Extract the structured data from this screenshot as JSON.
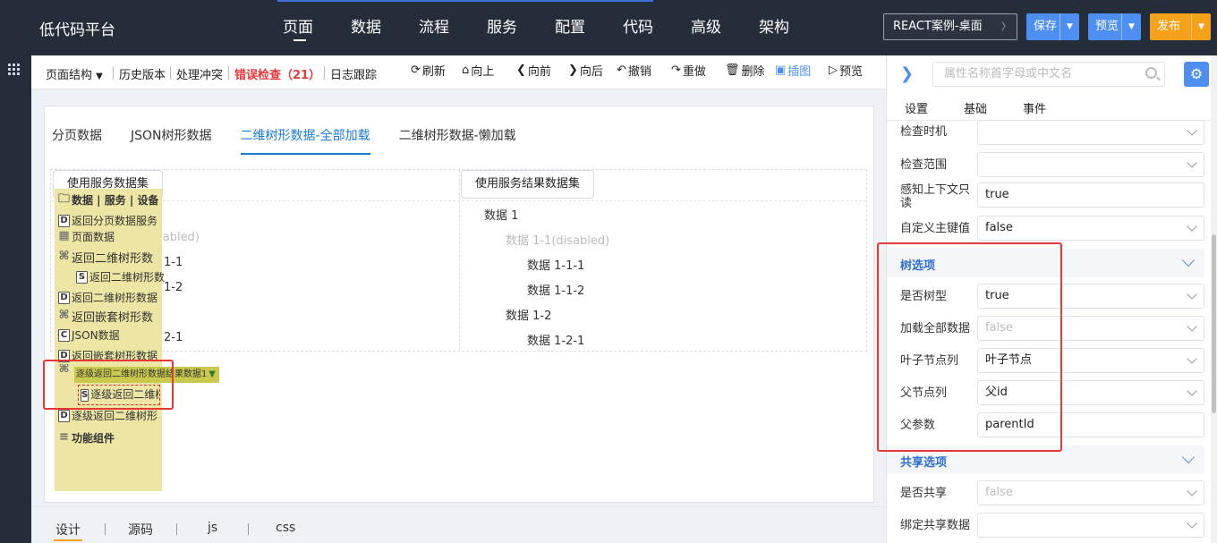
{
  "app": {
    "title": "低代码平台"
  },
  "topnav": [
    {
      "label": "页面",
      "active": true
    },
    {
      "label": "数据"
    },
    {
      "label": "流程"
    },
    {
      "label": "服务"
    },
    {
      "label": "配置"
    },
    {
      "label": "代码"
    },
    {
      "label": "高级"
    },
    {
      "label": "架构"
    }
  ],
  "topbar": {
    "env_select": "REACT案例-桌面",
    "save_label": "保存",
    "preview_label": "预览",
    "publish_label": "发布",
    "caret_icon": "chevron-down-icon"
  },
  "toolbar": {
    "page_structure": "页面结构",
    "history": "历史版本",
    "conflict": "处理冲突",
    "error_check": "错误检查（21）",
    "log_trace": "日志跟踪",
    "tools": [
      {
        "label": "刷新",
        "icon": "refresh-icon",
        "glyph": "⟳"
      },
      {
        "label": "向上",
        "icon": "home-up-icon",
        "glyph": "⌂"
      },
      {
        "label": "向前",
        "icon": "chevron-left-icon",
        "glyph": "❮"
      },
      {
        "label": "向后",
        "icon": "chevron-right-icon",
        "glyph": "❯"
      },
      {
        "label": "撤销",
        "icon": "undo-icon",
        "glyph": "↶"
      },
      {
        "label": "重做",
        "icon": "redo-icon",
        "glyph": "↷"
      },
      {
        "label": "删除",
        "icon": "trash-icon",
        "glyph": "🗑"
      },
      {
        "label": "插图",
        "icon": "image-icon",
        "glyph": "▣",
        "active": true
      },
      {
        "label": "预览",
        "icon": "play-icon",
        "glyph": "▷"
      }
    ]
  },
  "canvas": {
    "tabs": [
      {
        "label": "分页数据"
      },
      {
        "label": "JSON树形数据"
      },
      {
        "label": "二维树形数据-全部加载",
        "active": true
      },
      {
        "label": "二维树形数据-懒加载"
      }
    ],
    "left_button": "使用服务数据集",
    "right_button": "使用服务结果数据集",
    "left_tree_fragments": [
      "sabled)",
      "1-1",
      "1-2",
      "2-1"
    ],
    "right_tree": [
      {
        "label": "数据 1",
        "level": 0
      },
      {
        "label": "数据 1-1(disabled)",
        "level": 1,
        "disabled": true
      },
      {
        "label": "数据 1-1-1",
        "level": 2
      },
      {
        "label": "数据 1-1-2",
        "level": 2
      },
      {
        "label": "数据 1-2",
        "level": 1
      },
      {
        "label": "数据 1-2-1",
        "level": 2
      }
    ]
  },
  "component_panel": {
    "items": [
      {
        "label": "数据 | 服务 | 设备",
        "icon": "folder-icon",
        "glyph": "🗀",
        "bold": true
      },
      {
        "label": "返回分页数据服务",
        "icon": "d-icon",
        "glyph": "D"
      },
      {
        "label": "页面数据",
        "icon": "page-data-icon",
        "glyph": "▦"
      },
      {
        "label": "返回二维树形数",
        "icon": "cluster-icon",
        "glyph": "⌘"
      },
      {
        "label": "返回二维树形数",
        "icon": "s-icon",
        "glyph": "S",
        "indent": true
      },
      {
        "label": "返回二维树形数据",
        "icon": "d-icon",
        "glyph": "D"
      },
      {
        "label": "返回嵌套树形数",
        "icon": "cluster-icon",
        "glyph": "⌘"
      },
      {
        "label": "JSON数据",
        "icon": "c-icon",
        "glyph": "C"
      },
      {
        "label": "返回嵌套树形数据",
        "icon": "d-icon",
        "glyph": "D"
      }
    ],
    "selected_item": "逐级返回二维树形数据结果数据1",
    "selected_child": "逐级返回二维树",
    "after_items": [
      {
        "label": "逐级返回二维树形",
        "icon": "d-icon",
        "glyph": "D"
      },
      {
        "label": "功能组件",
        "icon": "function-icon",
        "glyph": "≡",
        "bold": true
      }
    ]
  },
  "bottom_tabs": [
    {
      "label": "设计",
      "active": true
    },
    {
      "label": "源码"
    },
    {
      "label": "js"
    },
    {
      "label": "css"
    }
  ],
  "property_panel": {
    "search_placeholder": "属性名称首字母或中文名",
    "tabs": [
      "设置",
      "基础",
      "事件"
    ],
    "rows_top": [
      {
        "label": "检查时机",
        "value": ""
      },
      {
        "label": "检查范围",
        "value": ""
      },
      {
        "label": "感知上下文只读",
        "value": "true",
        "chev": false
      },
      {
        "label": "自定义主键值",
        "value": "false"
      }
    ],
    "tree_section": {
      "title": "树选项",
      "rows": [
        {
          "label": "是否树型",
          "value": "true"
        },
        {
          "label": "加载全部数据",
          "value": "false",
          "muted": true
        },
        {
          "label": "叶子节点列",
          "value": "叶子节点"
        },
        {
          "label": "父节点列",
          "value": "父id"
        },
        {
          "label": "父参数",
          "value": "parentId",
          "chev": false
        }
      ]
    },
    "share_section": {
      "title": "共享选项",
      "rows": [
        {
          "label": "是否共享",
          "value": "false",
          "muted": true
        },
        {
          "label": "绑定共享数据",
          "value": ""
        }
      ]
    }
  },
  "colors": {
    "topbar_bg": "#262d3a",
    "accent_blue": "#4d8ff0",
    "publish_orange": "#f5a21a",
    "error_red": "#e4393c",
    "highlight_red": "#e53935",
    "component_panel_bg": "#ece5a3"
  }
}
